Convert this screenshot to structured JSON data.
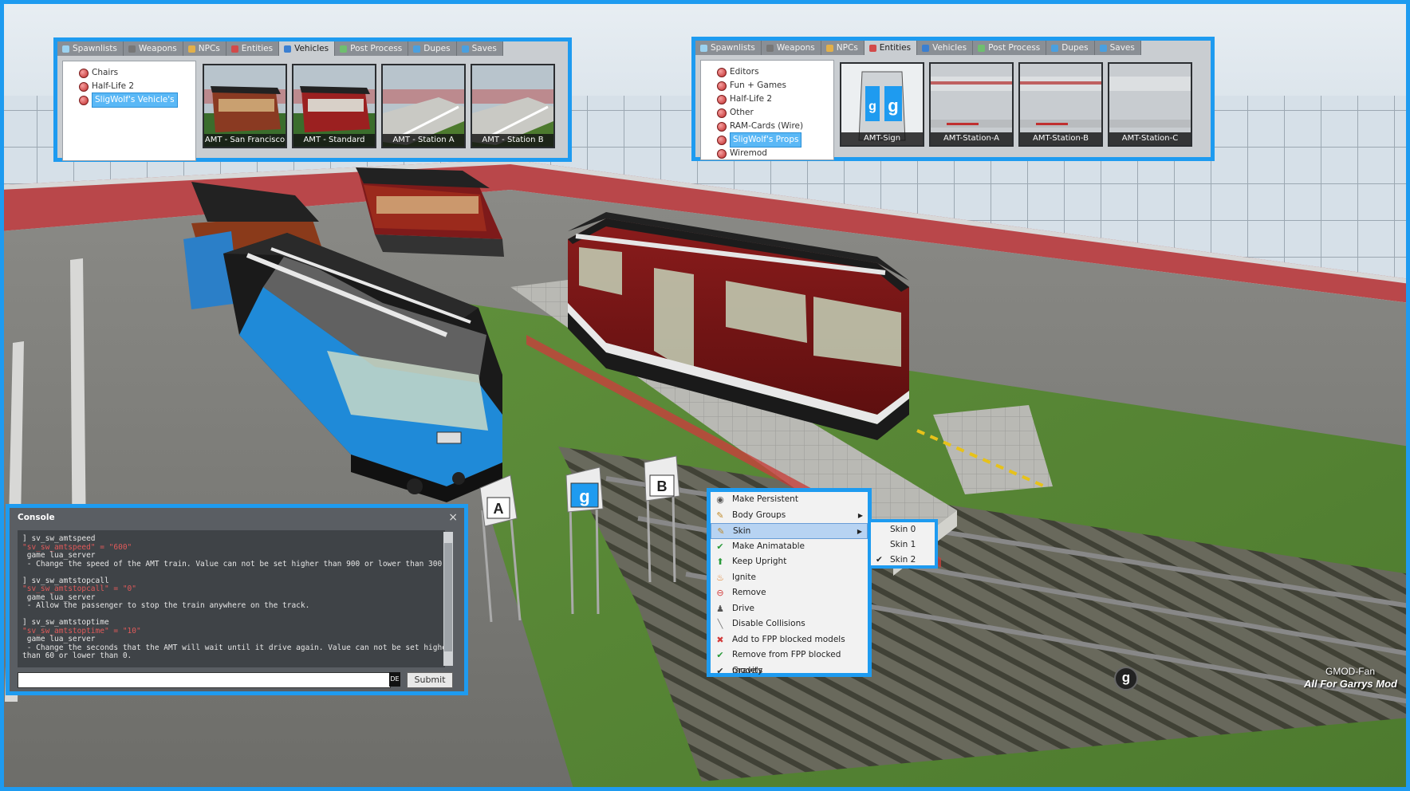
{
  "left_spawnmenu": {
    "tabs": [
      {
        "label": "Spawnlists",
        "color": "#9bd2f0"
      },
      {
        "label": "Weapons",
        "color": "#777777"
      },
      {
        "label": "NPCs",
        "color": "#e2b04a"
      },
      {
        "label": "Entities",
        "color": "#d24a4a"
      },
      {
        "label": "Vehicles",
        "color": "#3b7fd1"
      },
      {
        "label": "Post Process",
        "color": "#6fbf6f"
      },
      {
        "label": "Dupes",
        "color": "#4aa0e0"
      },
      {
        "label": "Saves",
        "color": "#4aa0e0"
      }
    ],
    "active_tab": "Vehicles",
    "tree": [
      "Chairs",
      "Half-Life 2",
      "SligWolf's Vehicle's"
    ],
    "selected_node": "SligWolf's Vehicle's",
    "icons": [
      "AMT - San Francisco",
      "AMT - Standard",
      "AMT - Station A",
      "AMT - Station B"
    ]
  },
  "right_spawnmenu": {
    "tabs": [
      {
        "label": "Spawnlists",
        "color": "#9bd2f0"
      },
      {
        "label": "Weapons",
        "color": "#777777"
      },
      {
        "label": "NPCs",
        "color": "#e2b04a"
      },
      {
        "label": "Entities",
        "color": "#d24a4a"
      },
      {
        "label": "Vehicles",
        "color": "#3b7fd1"
      },
      {
        "label": "Post Process",
        "color": "#6fbf6f"
      },
      {
        "label": "Dupes",
        "color": "#4aa0e0"
      },
      {
        "label": "Saves",
        "color": "#4aa0e0"
      }
    ],
    "active_tab": "Entities",
    "tree": [
      "Editors",
      "Fun + Games",
      "Half-Life 2",
      "Other",
      "RAM-Cards (Wire)",
      "SligWolf's Props",
      "Wiremod"
    ],
    "selected_node": "SligWolf's Props",
    "icons": [
      "AMT-Sign",
      "AMT-Station-A",
      "AMT-Station-B",
      "AMT-Station-C"
    ]
  },
  "console": {
    "title": "Console",
    "close_icon": "×",
    "lines": [
      {
        "text": "] sv_sw_amtspeed",
        "red": false
      },
      {
        "text": "\"sv_sw_amtspeed\" = \"600\"",
        "red": true
      },
      {
        "text": " game lua_server",
        "red": false
      },
      {
        "text": " - Change the speed of the AMT train. Value can not be set higher than 900 or lower than 300.",
        "red": false
      },
      {
        "text": "",
        "red": false
      },
      {
        "text": "] sv_sw_amtstopcall",
        "red": false
      },
      {
        "text": "\"sv_sw_amtstopcall\" = \"0\"",
        "red": true
      },
      {
        "text": " game lua_server",
        "red": false
      },
      {
        "text": " - Allow the passenger to stop the train anywhere on the track.",
        "red": false
      },
      {
        "text": "",
        "red": false
      },
      {
        "text": "] sv_sw_amtstoptime",
        "red": false
      },
      {
        "text": "\"sv_sw_amtstoptime\" = \"10\"",
        "red": true
      },
      {
        "text": " game lua_server",
        "red": false
      },
      {
        "text": " - Change the seconds that the AMT will wait until it drive again. Value can not be set higher",
        "red": false
      },
      {
        "text": "than 60 or lower than 0.",
        "red": false
      }
    ],
    "input_value": "",
    "lang": "DE",
    "submit_label": "Submit"
  },
  "context_menu": {
    "items": [
      {
        "label": "Make Persistent",
        "icon": "persist-icon",
        "glyph": "◉",
        "color": "#555555",
        "submenu": false
      },
      {
        "label": "Body Groups",
        "icon": "wrench-icon",
        "glyph": "✎",
        "color": "#c08a2a",
        "submenu": true
      },
      {
        "label": "Skin",
        "icon": "brush-icon",
        "glyph": "✎",
        "color": "#c08a2a",
        "submenu": true,
        "highlighted": true
      },
      {
        "label": "Make Animatable",
        "icon": "check-icon",
        "glyph": "✔",
        "color": "#2a9a3a",
        "submenu": false
      },
      {
        "label": "Keep Upright",
        "icon": "arrow-up-icon",
        "glyph": "⬆",
        "color": "#2a9a3a",
        "submenu": false
      },
      {
        "label": "Ignite",
        "icon": "fire-icon",
        "glyph": "♨",
        "color": "#e07a20",
        "submenu": false
      },
      {
        "label": "Remove",
        "icon": "remove-icon",
        "glyph": "⊖",
        "color": "#d23a3a",
        "submenu": false
      },
      {
        "label": "Drive",
        "icon": "driver-icon",
        "glyph": "♟",
        "color": "#555555",
        "submenu": false
      },
      {
        "label": "Disable Collisions",
        "icon": "collision-icon",
        "glyph": "╲",
        "color": "#777777",
        "submenu": false
      },
      {
        "label": "Add to FPP blocked models",
        "icon": "cross-icon",
        "glyph": "✖",
        "color": "#d23a3a",
        "submenu": false
      },
      {
        "label": "Remove from FPP blocked models",
        "icon": "check-icon",
        "glyph": "✔",
        "color": "#2a9a3a",
        "submenu": false
      },
      {
        "label": "Gravity",
        "icon": "checkmark-icon",
        "glyph": "✔",
        "color": "#333333",
        "submenu": false
      }
    ],
    "skin_submenu": [
      {
        "label": "Skin 0",
        "checked": false
      },
      {
        "label": "Skin 1",
        "checked": false
      },
      {
        "label": "Skin 2",
        "checked": true
      }
    ]
  },
  "scene": {
    "signs": [
      "A",
      "g",
      "B"
    ]
  },
  "watermark": {
    "logo": "g",
    "line1": "GMOD-Fan",
    "line2": "All For Garrys Mod"
  },
  "colors": {
    "accent": "#1e9bf0",
    "menu_bg": "#c9cdd1",
    "console_bg": "#5a5e63",
    "highlight": "#b7d3f2"
  }
}
